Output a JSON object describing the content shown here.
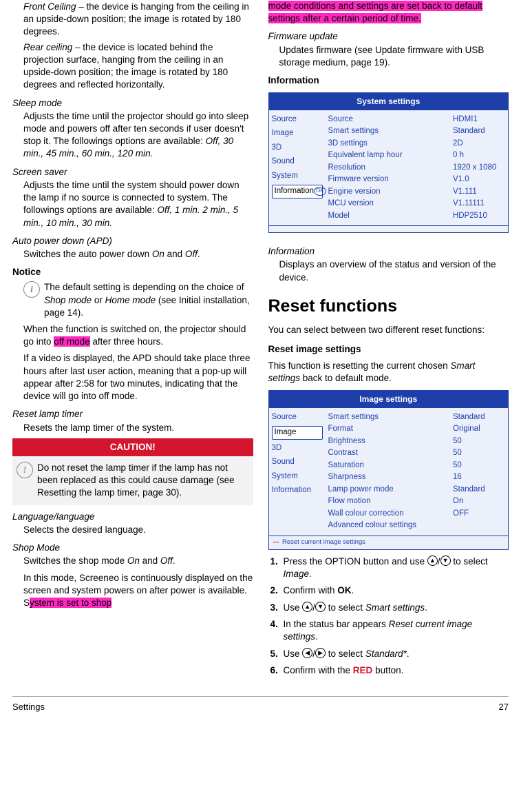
{
  "left": {
    "front_ceiling_label": "Front Ceiling",
    "front_ceiling_text": " – the device is hanging from the ceiling in an upside-down position; the image is rotated by 180 degrees.",
    "rear_ceiling_label": "Rear ceiling",
    "rear_ceiling_text": " – the device is located behind the projection surface, hanging from the ceiling in an upside-down position; the image is rotated by 180 degrees and reflected horizontally.",
    "sleep_mode_term": "Sleep mode",
    "sleep_mode_def_pre": "Adjusts the time until the projector should go into sleep mode and powers off after ten seconds if user doesn't stop it. The followings options are available: ",
    "sleep_mode_opts": "Off, 30 min., 45 min., 60 min., 120 min.",
    "screen_saver_term": "Screen saver",
    "screen_saver_def_pre": "Adjusts the time until the system should power down the lamp if no source is connected to system. The followings options are available: ",
    "screen_saver_opts": "Off, 1 min. 2 min., 5 min., 10 min., 30 min.",
    "apd_term": "Auto power down (APD)",
    "apd_def_pre": "Switches the auto power down ",
    "apd_on": "On",
    "apd_and": " and ",
    "apd_off": "Off",
    "apd_period": ".",
    "notice_hd": "Notice",
    "notice_text_pre": "The default setting is depending on the choice of ",
    "notice_shop": "Shop mode",
    "notice_or": " or ",
    "notice_home": "Home mode",
    "notice_post": " (see Initial installation, page 14).",
    "apd_para1_pre": "When the function is switched on, the projector should go into ",
    "apd_para1_hl": "off mode",
    "apd_para1_post": " after three hours.",
    "apd_para2": "If a video is displayed, the APD should take place three hours after last user action, meaning that a pop-up will appear after 2:58 for two minutes, indicating that the device will go into off mode.",
    "reset_lamp_term": "Reset lamp timer",
    "reset_lamp_def": "Resets the lamp timer of the system.",
    "caution_title": "CAUTION!",
    "caution_text": "Do not reset the lamp timer if the lamp has not been replaced as this could cause damage  (see Resetting the lamp timer, page 30).",
    "lang_term": "Language/language",
    "lang_def": "Selects the desired language.",
    "shopmode_term": "Shop Mode",
    "shopmode_def_pre": "Switches the shop mode ",
    "shopmode_on": "On",
    "shopmode_and": " and ",
    "shopmode_off": "Off",
    "shopmode_period": ".",
    "shopmode_para_pre": "In this mode, Screeneo is continuously displayed on the screen and system powers on after power is available. S",
    "shopmode_para_hl": "ystem is set to shop"
  },
  "right": {
    "hl_cont": "mode conditions and settings are set back to default settings after a certain period of time.",
    "fw_term": "Firmware update",
    "fw_def": "Updates firmware  (see Update firmware with USB storage medium, page 19).",
    "info_hd": "Information",
    "panel1": {
      "title": "System settings",
      "left": [
        "Source",
        "Image",
        "3D",
        "Sound",
        "System"
      ],
      "left_sel": "Information",
      "ok": "OK",
      "mid": [
        "Source",
        "Smart settings",
        "3D settings",
        "Equivalent lamp hour",
        "Resolution",
        "Firmware version",
        "Engine version",
        "MCU version",
        "Model"
      ],
      "right": [
        "HDMI1",
        "Standard",
        "2D",
        "0 h",
        "1920 x 1080",
        "V1.0",
        "V1.111",
        "V1.11111",
        "HDP2510"
      ]
    },
    "info_term": "Information",
    "info_def": "Displays an overview of the status and version of the device.",
    "reset_hd": "Reset functions",
    "reset_intro": "You can select between two different reset functions:",
    "reset_img_hd": "Reset image settings",
    "reset_img_p_pre": "This function is resetting the current chosen ",
    "reset_img_p_ital": "Smart settings",
    "reset_img_p_post": " back to default mode.",
    "panel2": {
      "title": "Image settings",
      "left_pre": [
        "Source"
      ],
      "left_sel": "Image",
      "left_post": [
        "3D",
        "Sound",
        "System",
        "Information"
      ],
      "mid": [
        "Smart settings",
        "Format",
        "Brightness",
        "Contrast",
        "Saturation",
        "Sharpness",
        "Lamp power mode",
        "Flow motion",
        "Wall colour correction",
        "Advanced colour settings"
      ],
      "right": [
        "Standard",
        "Original",
        "50",
        "50",
        "50",
        "16",
        "Standard",
        "On",
        "OFF",
        ""
      ],
      "foot": "Reset current image settings"
    },
    "steps": {
      "s1_pre": "Press the OPTION button and use ",
      "s1_mid": " to select ",
      "s1_ital": "Image",
      "s1_post": ".",
      "s2_pre": "Confirm with ",
      "s2_ok": "OK",
      "s2_post": ".",
      "s3_pre": "Use ",
      "s3_mid": " to select ",
      "s3_ital": "Smart settings",
      "s3_post": ".",
      "s4_pre": "In the status bar appears ",
      "s4_ital": "Reset current image settings",
      "s4_post": ".",
      "s5_pre": "Use ",
      "s5_mid": " to select ",
      "s5_ital": "Standard*",
      "s5_post": ".",
      "s6_pre": "Confirm with the ",
      "s6_red": "RED",
      "s6_post": " button."
    }
  },
  "footer": {
    "left": "Settings",
    "right": "27"
  }
}
